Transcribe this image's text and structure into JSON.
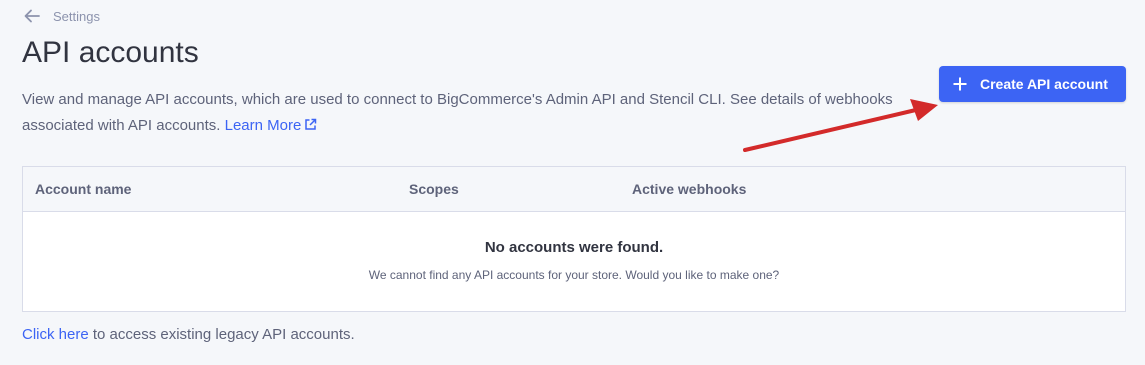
{
  "breadcrumb": {
    "back_icon": "arrow-left-icon",
    "label": "Settings"
  },
  "page": {
    "title": "API accounts",
    "description_text": "View and manage API accounts, which are used to connect to BigCommerce's Admin API and Stencil CLI. See details of webhooks associated with API accounts.",
    "learn_more_label": "Learn More",
    "external_icon": "external-link-icon"
  },
  "actions": {
    "create_label": "Create API account",
    "create_icon": "plus-icon"
  },
  "table": {
    "columns": [
      "Account name",
      "Scopes",
      "Active webhooks"
    ],
    "empty_title": "No accounts were found.",
    "empty_message": "We cannot find any API accounts for your store. Would you like to make one?"
  },
  "legacy": {
    "link_label": "Click here",
    "rest_text": " to access existing legacy API accounts."
  },
  "colors": {
    "accent": "#3c64f4",
    "annotation_arrow": "#d32a2a",
    "background": "#f5f7fa"
  }
}
